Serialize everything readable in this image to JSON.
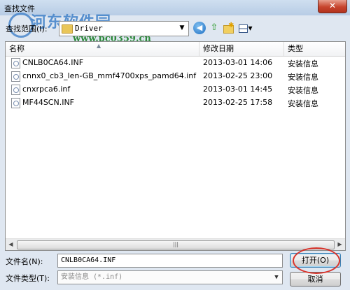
{
  "window": {
    "title": "查找文件",
    "close_symbol": "✕"
  },
  "watermark": {
    "text": "河东软件园",
    "url": "www.pc0359.cn"
  },
  "lookin": {
    "label": "查找范围(I):",
    "value": "Driver",
    "dropdown_symbol": "▼"
  },
  "toolbar": {
    "back_symbol": "◀",
    "up_symbol": "⇧",
    "new_folder_symbol": "✱",
    "view_symbol": "▾"
  },
  "columns": {
    "name": "名称",
    "date": "修改日期",
    "type": "类型",
    "sort_symbol": "▲"
  },
  "files": [
    {
      "name": "CNLB0CA64.INF",
      "date": "2013-03-01 14:06",
      "type": "安装信息"
    },
    {
      "name": "cnnx0_cb3_len-GB_mmf4700xps_pamd64.inf",
      "date": "2013-02-25 23:00",
      "type": "安装信息"
    },
    {
      "name": "cnxrpca6.inf",
      "date": "2013-03-01 14:45",
      "type": "安装信息"
    },
    {
      "name": "MF44SCN.INF",
      "date": "2013-02-25 17:58",
      "type": "安装信息"
    }
  ],
  "scrollbar": {
    "left_symbol": "◀",
    "right_symbol": "▶",
    "grip_symbol": "|||"
  },
  "filename": {
    "label": "文件名(N):",
    "value": "CNLB0CA64.INF"
  },
  "filetype": {
    "label": "文件类型(T):",
    "value": "安装信息 (*.inf)",
    "dropdown_symbol": "▼"
  },
  "buttons": {
    "open": "打开(O)",
    "cancel": "取消"
  },
  "colors": {
    "title_bar": "#b7cce5",
    "close_button": "#c7442d",
    "highlight_circle": "#d9342b"
  }
}
